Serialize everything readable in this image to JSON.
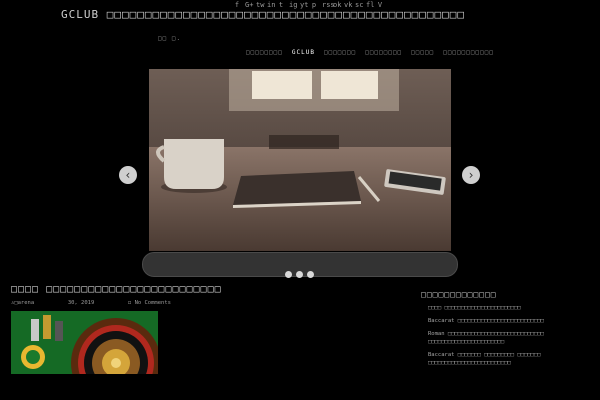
{
  "social_icons": [
    "f",
    "G+",
    "tw",
    "in",
    "t",
    "ig",
    "yt",
    "p",
    "rss",
    "ok",
    "vk",
    "sc",
    "fl",
    "V"
  ],
  "header": {
    "site_title": "GCLUB □□□□□□□□□□□□□□□□□□□□□□□□□□□□□□□□□□□□□□□□□□□□□□□",
    "tagline": "□□ □."
  },
  "nav": {
    "items": [
      "□□□□□□□□",
      "GCLUB",
      "□□□□□□□",
      "□□□□□□□□",
      "□□□□□",
      "□□□□□□□□□□□"
    ],
    "active_index": 1
  },
  "slider": {
    "prev_label": "‹",
    "next_label": "›",
    "dot_count": 3
  },
  "post": {
    "title": "□□□□ □□□□□□□□□□□□□□□□□□□□□□□□□",
    "author": "□arena",
    "date": "30, 2019",
    "comments": "No Comments"
  },
  "sidebar": {
    "widget_title": "□□□□□□□□□□□□□",
    "recent_posts": [
      [
        "□□□□ □□□□□□□□□□□□□□□□□□□□□□□"
      ],
      [
        "Baccarat □□□□□□□□□□□□□□□□□□□□□□□□□□"
      ],
      [
        "Roman □□□□□□□□□□□□□□□□□□□□□□□□□□□□□",
        "□□□□□□□□□□□□□□□□□□□□□□□"
      ],
      [
        "Baccarat □□□□□□□ □□□□□□□□□ □□□□□□□",
        "□□□□□□□□□□□□□□□□□□□□□□□□□"
      ]
    ]
  },
  "colors": {
    "background": "#000000",
    "text": "#bdbdbd",
    "slider_caption": "#333333"
  }
}
